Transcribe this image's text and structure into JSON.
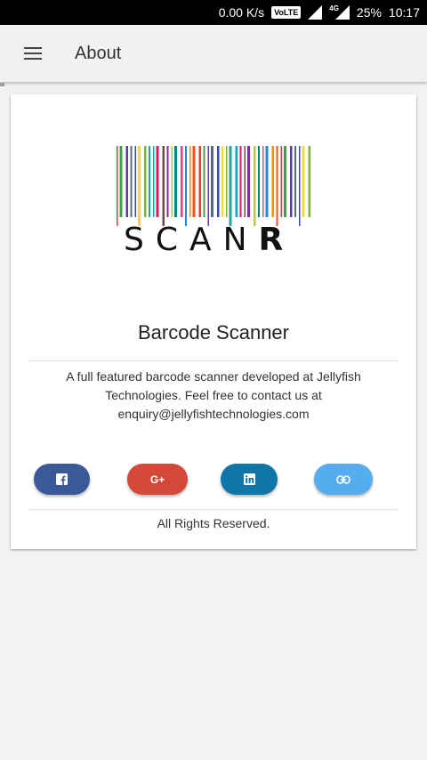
{
  "status_bar": {
    "speed": "0.00 K/s",
    "volte": "VoLTE",
    "network": "4G",
    "battery": "25%",
    "time": "10:17"
  },
  "app_bar": {
    "menu_icon": "hamburger-menu-icon",
    "title": "About"
  },
  "about_card": {
    "logo_text": "SCAN",
    "logo_text_bold": "R",
    "app_name": "Barcode Scanner",
    "description": "A full featured barcode scanner developed at Jellyfish Technologies. Feel free to contact us at enquiry@jellyfishtechnologies.com",
    "social_buttons": [
      {
        "name": "facebook",
        "icon": "facebook-icon",
        "color": "#3b5998"
      },
      {
        "name": "google-plus",
        "icon": "google-plus-icon",
        "label": "G+",
        "color": "#d34836"
      },
      {
        "name": "linkedin",
        "icon": "linkedin-icon",
        "color": "#0e76a8"
      },
      {
        "name": "website",
        "icon": "link-icon",
        "color": "#55acee"
      }
    ],
    "footer": "All Rights Reserved."
  }
}
